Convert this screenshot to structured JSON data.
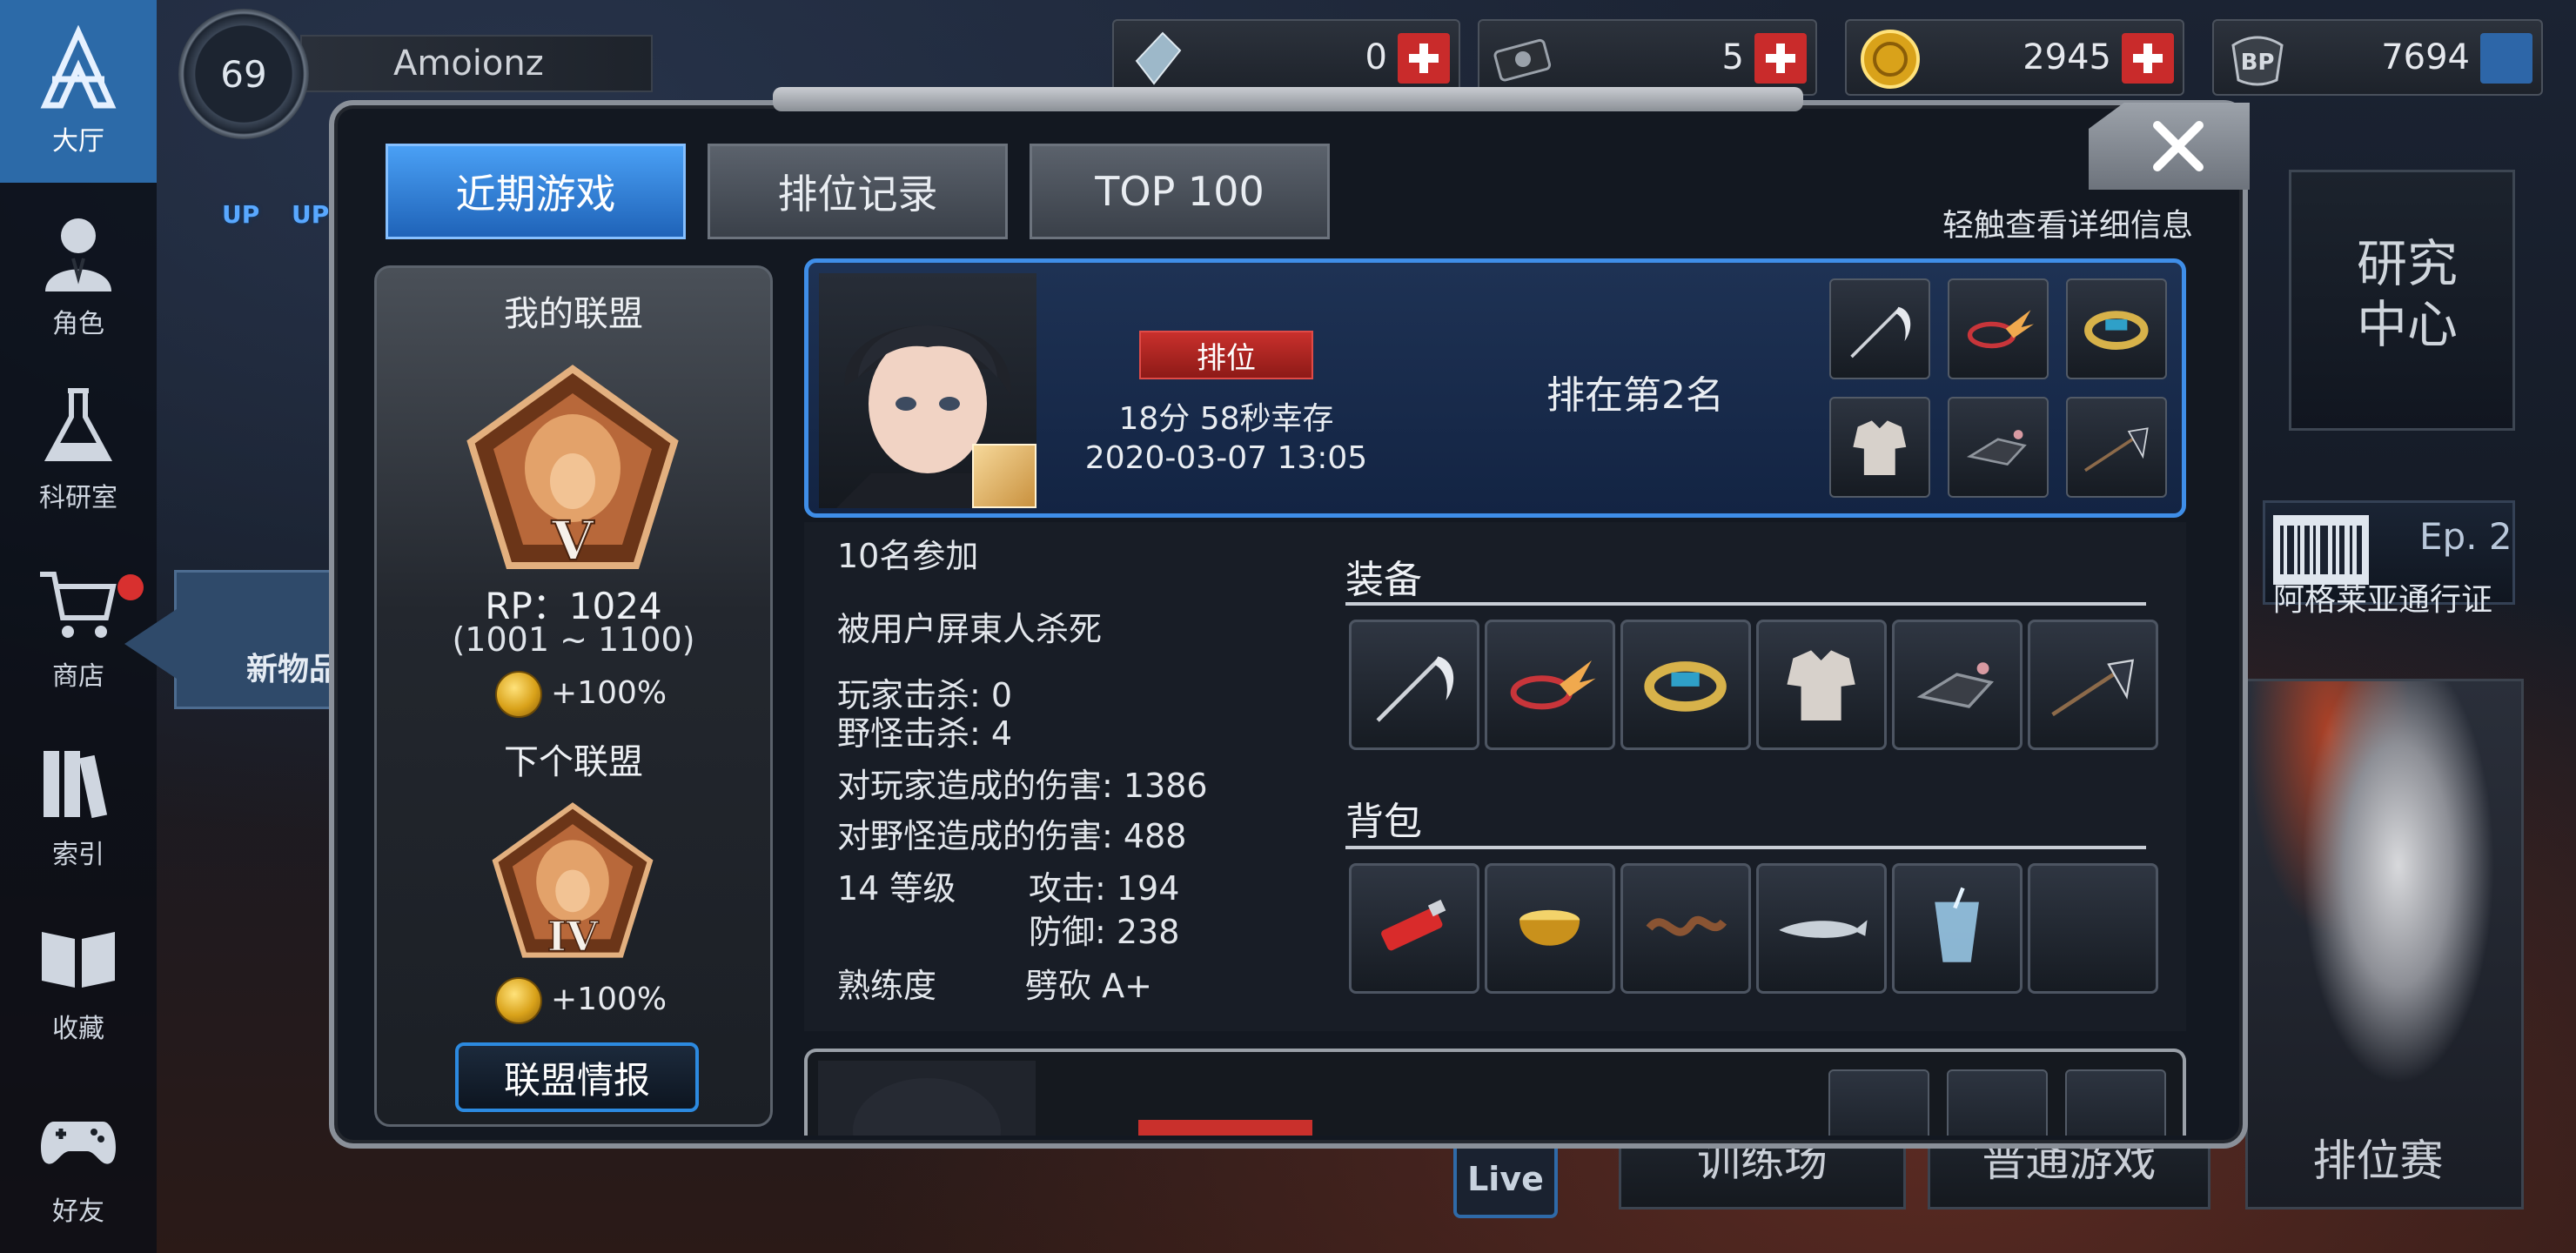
{
  "nav": {
    "items": [
      {
        "label": "大厅",
        "icon": "lobby-star-icon"
      },
      {
        "label": "角色",
        "icon": "character-icon"
      },
      {
        "label": "科研室",
        "icon": "flask-icon"
      },
      {
        "label": "商店",
        "icon": "cart-icon"
      },
      {
        "label": "索引",
        "icon": "books-icon"
      },
      {
        "label": "收藏",
        "icon": "open-book-icon"
      },
      {
        "label": "好友",
        "icon": "gamepad-icon"
      }
    ]
  },
  "player": {
    "level": "69",
    "name": "Amoionz"
  },
  "upgrade_badges": [
    "UP",
    "UP"
  ],
  "resources": [
    {
      "name": "crystal",
      "value": "0",
      "icon": "crystal-icon"
    },
    {
      "name": "ticket",
      "value": "5",
      "icon": "ticket-icon"
    },
    {
      "name": "coin",
      "value": "2945",
      "icon": "coin-icon"
    },
    {
      "name": "bp",
      "value": "7694",
      "icon": "bp-icon"
    }
  ],
  "new_items_tag": "新物品",
  "right_panel": {
    "research_center": "研究中心",
    "pass_ep": "Ep. 2",
    "pass_title": "阿格莱亚通行证"
  },
  "bottom_buttons": [
    "训练场",
    "普通游戏",
    "排位赛"
  ],
  "live_label": "Live",
  "modal": {
    "tabs": [
      {
        "label": "近期游戏",
        "active": true
      },
      {
        "label": "排位记录",
        "active": false
      },
      {
        "label": "TOP 100",
        "active": false
      }
    ],
    "hint": "轻触查看详细信息"
  },
  "league": {
    "my_league_title": "我的联盟",
    "current_tier": "V",
    "rp": "RP：1024",
    "range": "(1001 ~ 1100)",
    "current_bonus": "+100%",
    "next_league_title": "下个联盟",
    "next_tier": "IV",
    "next_bonus": "+100%",
    "info_button": "联盟情报"
  },
  "match": {
    "mode": "排位",
    "survival": "18分 58秒幸存",
    "datetime": "2020-03-07 13:05",
    "placement": "排在第2名",
    "equipment_icons": [
      "scythe-icon",
      "wing-circlet-icon",
      "bracelet-icon",
      "armor-icon",
      "gauntlet-icon",
      "spear-flag-icon"
    ]
  },
  "details": {
    "participants": "10名参加",
    "killed_by": "被用户屏東人杀死",
    "player_kills": "玩家击杀: 0",
    "monster_kills": "野怪击杀: 4",
    "player_damage": "对玩家造成的伤害: 1386",
    "monster_damage": "对野怪造成的伤害: 488",
    "level": "14 等级",
    "attack": "攻击: 194",
    "defense": "防御: 238",
    "proficiency_label": "熟练度",
    "proficiency_value": "劈砍 A+",
    "equipment_title": "装备",
    "backpack_title": "背包",
    "equipment": [
      "scythe-icon",
      "wing-circlet-icon",
      "bracelet-icon",
      "armor-icon",
      "gauntlet-icon",
      "spear-flag-icon"
    ],
    "backpack": [
      "lighter-icon",
      "gold-bowl-icon",
      "rope-icon",
      "fish-icon",
      "cup-icon",
      "empty-slot"
    ]
  },
  "colors": {
    "accent": "#3f8ee8",
    "rank_red": "#c9302c",
    "panel": "#181d26"
  }
}
